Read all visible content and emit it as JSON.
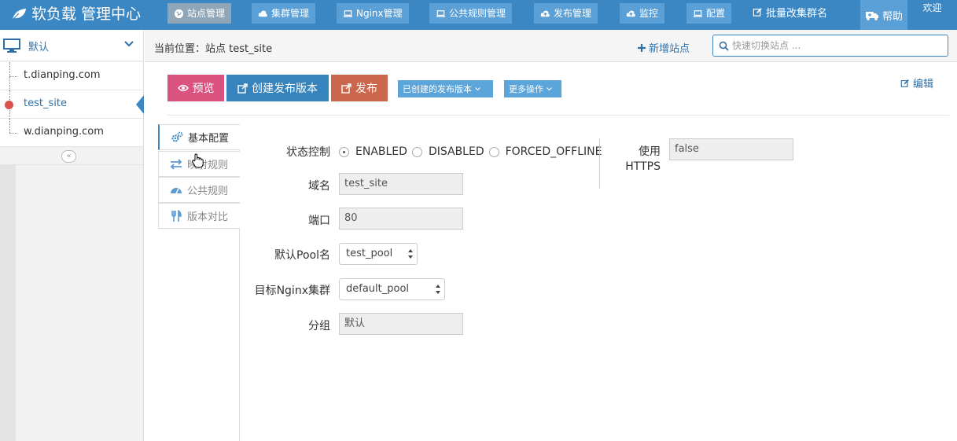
{
  "navbar": {
    "brand": "软负载 管理中心",
    "items": [
      {
        "label": "站点管理",
        "icon": "globe-icon",
        "active": true
      },
      {
        "label": "集群管理",
        "icon": "cloud-icon",
        "active": false
      },
      {
        "label": "Nginx管理",
        "icon": "laptop-icon",
        "active": false
      },
      {
        "label": "公共规则管理",
        "icon": "laptop-icon",
        "active": false
      },
      {
        "label": "发布管理",
        "icon": "cloud-upload-icon",
        "active": false
      },
      {
        "label": "监控",
        "icon": "cloud-upload-icon",
        "active": false
      },
      {
        "label": "配置",
        "icon": "laptop-icon",
        "active": false
      }
    ],
    "batch_label": "批量改集群名",
    "help_label": "帮助",
    "welcome_label": "欢迎"
  },
  "sidebar": {
    "group_name": "默认",
    "sites": [
      {
        "name": "t.dianping.com",
        "active": false
      },
      {
        "name": "test_site",
        "active": true
      },
      {
        "name": "w.dianping.com",
        "active": false
      }
    ],
    "collapse_label": "«"
  },
  "breadcrumb": {
    "text": "当前位置：站点 test_site",
    "add_site_label": "新增站点",
    "search_placeholder": "快速切换站点 ..."
  },
  "actions": {
    "preview_label": "预览",
    "create_version_label": "创建发布版本",
    "publish_label": "发布",
    "versions_dropdown_label": "已创建的发布版本",
    "more_label": "更多操作",
    "edit_label": "编辑"
  },
  "tabs": [
    {
      "label": "基本配置",
      "icon": "cogs-icon",
      "active": true
    },
    {
      "label": "映射规则",
      "icon": "exchange-icon",
      "active": false
    },
    {
      "label": "公共规则",
      "icon": "dashboard-icon",
      "active": false
    },
    {
      "label": "版本对比",
      "icon": "cutlery-icon",
      "active": false
    }
  ],
  "form": {
    "status_label": "状态控制",
    "status_options": [
      "ENABLED",
      "DISABLED",
      "FORCED_OFFLINE"
    ],
    "status_selected": "ENABLED",
    "domain_label": "域名",
    "domain_value": "test_site",
    "port_label": "端口",
    "port_value": "80",
    "pool_label": "默认Pool名",
    "pool_value": "test_pool",
    "cluster_label": "目标Nginx集群",
    "cluster_value": "default_pool",
    "group_label": "分组",
    "group_value": "默认",
    "https_label_line1": "使用",
    "https_label_line2": "HTTPS",
    "https_value": "false"
  },
  "colors": {
    "navbar": "#3b87c4",
    "preview": "#d9537e",
    "create": "#3783bd",
    "publish": "#c9664b",
    "dropdown": "#5ba5da"
  }
}
